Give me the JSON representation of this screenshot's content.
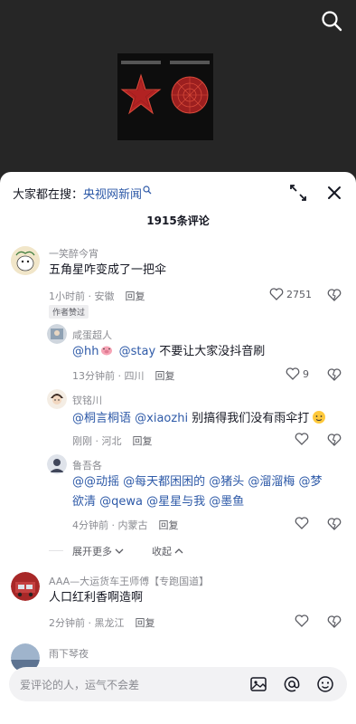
{
  "search_hint": {
    "label": "大家都在搜：",
    "link": "央视网新闻"
  },
  "comment_count": "1915条评论",
  "comments": [
    {
      "user": "一笑醉今宵",
      "text": "五角星咋变成了一把伞",
      "time": "1小时前 · 安徽",
      "reply_label": "回复",
      "likes": "2751",
      "badge": "作者赞过"
    },
    {
      "user": "咸蛋超人",
      "text_parts": [
        "@hh",
        " ",
        "@stay",
        " 不要让大家没抖音刷"
      ],
      "time": "13分钟前 · 四川",
      "reply_label": "回复",
      "likes": "9"
    },
    {
      "user": "钗铭川",
      "text_parts": [
        "@桐言桐语",
        " ",
        "@xiaozhi",
        " 别搞得我们没有雨伞打"
      ],
      "time": "刚刚 · 河北",
      "reply_label": "回复"
    },
    {
      "user": "鲁吾各",
      "text_line1": "@@动摇 @每天都困困的 @猪头 @溜溜梅 @梦",
      "text_line2": "欲清 @qewa @星星与我 @墨鱼",
      "time": "4分钟前 · 内蒙古",
      "reply_label": "回复"
    },
    {
      "user": "AAA—大运货车王师傅【专跑国道】",
      "text": "人口红利香啊造啊",
      "time": "2分钟前 · 黑龙江",
      "reply_label": "回复"
    },
    {
      "user": "雨下琴夜"
    }
  ],
  "expand_more": "展开更多",
  "collapse": "收起",
  "input_placeholder": "爱评论的人，运气不会差",
  "colors": {
    "link": "#2e5aa8",
    "muted": "#8a8b91",
    "text": "#161823"
  }
}
